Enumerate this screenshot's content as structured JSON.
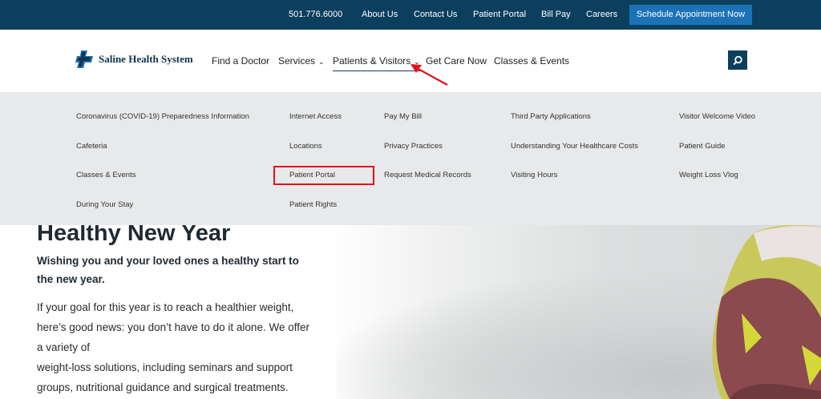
{
  "topbar": {
    "phone": "501.776.6000",
    "about": "About Us",
    "contact": "Contact Us",
    "portal": "Patient Portal",
    "billpay": "Bill Pay",
    "careers": "Careers",
    "schedule": "Schedule Appointment Now"
  },
  "logo": {
    "text": "Saline Health System",
    "icon": "cross-logo-icon"
  },
  "nav": {
    "find_doctor": "Find a Doctor",
    "services": "Services",
    "patients_visitors": "Patients & Visitors",
    "get_care": "Get Care Now",
    "classes": "Classes & Events",
    "search_icon": "search-icon"
  },
  "dropdown": {
    "col1": [
      "Coronavirus (COVID-19) Preparedness Information",
      "Cafeteria",
      "Classes & Events",
      "During Your Stay"
    ],
    "col2": [
      "Internet Access",
      "Locations",
      "Patient Portal",
      "Patient Rights"
    ],
    "col3": [
      "Pay My Bill",
      "Privacy Practices",
      "Request Medical Records"
    ],
    "col4": [
      "Third Party Applications",
      "Understanding Your Healthcare Costs",
      "Visiting Hours"
    ],
    "col5": [
      "Visitor Welcome Video",
      "Patient Guide",
      "Weight Loss Vlog"
    ]
  },
  "hero": {
    "title": "Healthy New Year",
    "subtitle": "Wishing you and your loved ones a healthy start to the new year.",
    "body_lines": [
      "If your goal for this year is to reach a healthier weight,",
      "here’s good news: you don’t have to do it alone. We offer",
      "a variety of",
      "weight-loss solutions, including seminars and support",
      "groups, nutritional guidance and surgical treatments."
    ]
  },
  "colors": {
    "topbar": "#0c3f5e",
    "schedule_button": "#1c72b6",
    "dropdown_bg": "#e8e9ea",
    "annotation": "#e0141e"
  }
}
